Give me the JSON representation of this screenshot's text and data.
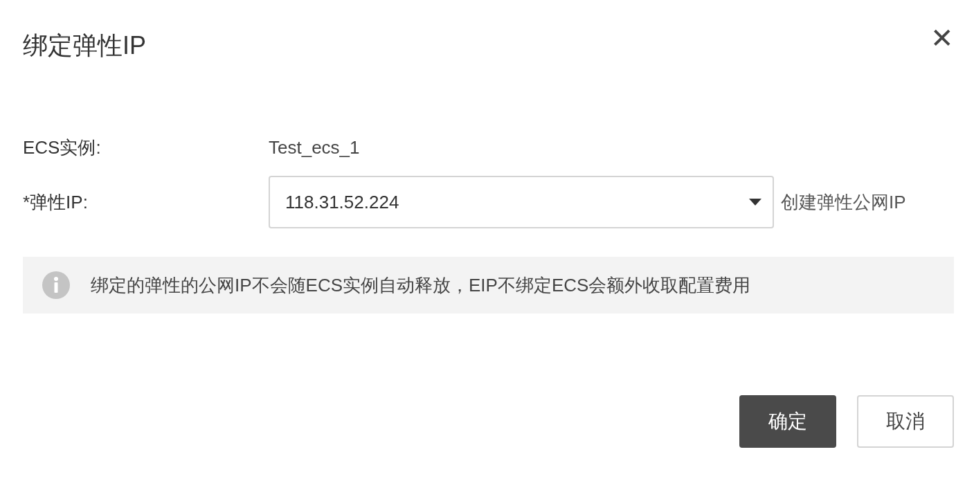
{
  "dialog": {
    "title": "绑定弹性IP",
    "close": "✕"
  },
  "fields": [
    {
      "kind": "text",
      "label": "ECS实例:",
      "value": "Test_ecs_1"
    },
    {
      "kind": "select",
      "label": "*弹性IP:",
      "value": "118.31.52.224",
      "link": "创建弹性公网IP"
    }
  ],
  "notice": {
    "text": "绑定的弹性的公网IP不会随ECS实例自动释放，EIP不绑定ECS会额外收取配置费用"
  },
  "buttons": [
    {
      "label": "确定",
      "kind": "primary"
    },
    {
      "label": "取消",
      "kind": "default"
    }
  ]
}
